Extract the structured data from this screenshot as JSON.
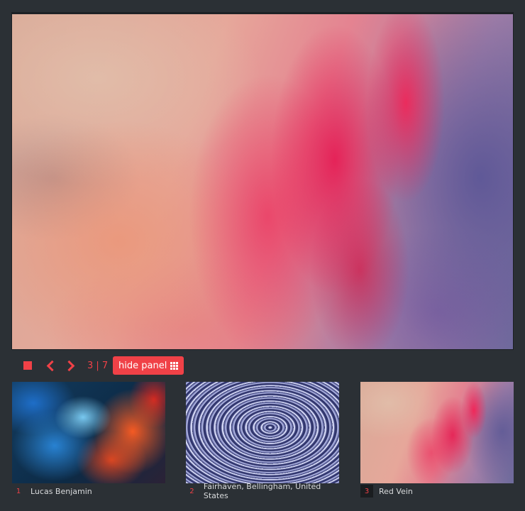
{
  "viewer": {
    "main_image": {
      "subject": "pink and purple ink clouds in water"
    },
    "controls": {
      "stop_icon": "stop-icon",
      "prev_icon": "chevron-left-icon",
      "next_icon": "chevron-right-icon",
      "counter": "3 | 7",
      "hide_panel_label": "hide panel",
      "grid_icon": "grid-icon"
    },
    "accent_color": "#f04147"
  },
  "thumbnails": [
    {
      "index": "1",
      "caption": "Lucas Benjamin"
    },
    {
      "index": "2",
      "caption": "Fairhaven, Bellingham, United States"
    },
    {
      "index": "3",
      "caption": "Red Vein",
      "active": true
    }
  ]
}
